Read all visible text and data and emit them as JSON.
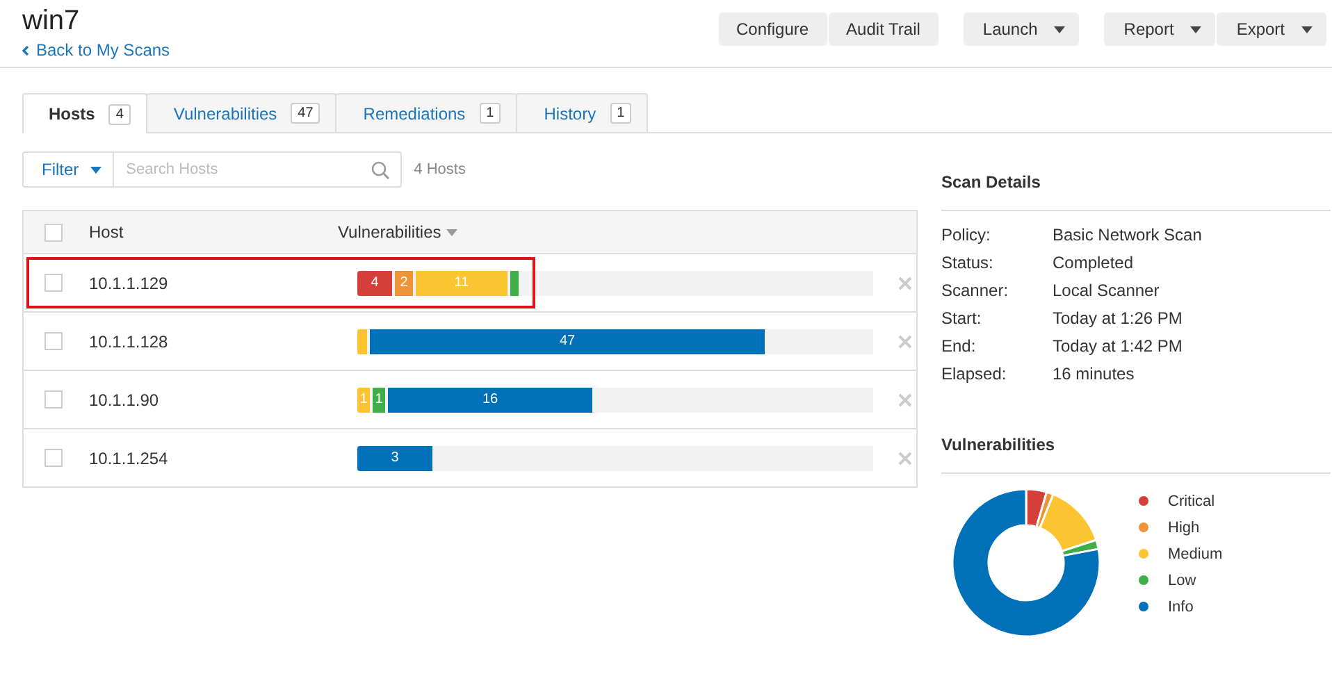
{
  "header": {
    "title": "win7",
    "back_link": "Back to My Scans",
    "button_groups": [
      [
        {
          "label": "Configure",
          "dropdown": false
        },
        {
          "label": "Audit Trail",
          "dropdown": false
        }
      ],
      [
        {
          "label": "Launch",
          "dropdown": true
        }
      ],
      [
        {
          "label": "Report",
          "dropdown": true
        },
        {
          "label": "Export",
          "dropdown": true
        }
      ]
    ]
  },
  "tabs": [
    {
      "label": "Hosts",
      "count": "4",
      "selected": true
    },
    {
      "label": "Vulnerabilities",
      "count": "47",
      "selected": false
    },
    {
      "label": "Remediations",
      "count": "1",
      "selected": false
    },
    {
      "label": "History",
      "count": "1",
      "selected": false
    }
  ],
  "filter": {
    "label": "Filter",
    "placeholder": "Search Hosts",
    "result_count": "4 Hosts"
  },
  "table": {
    "columns": [
      "Host",
      "Vulnerabilities"
    ],
    "all_checked": false,
    "rows": [
      {
        "host": "10.1.1.129",
        "checked": false,
        "highlighted": true,
        "segments": [
          {
            "label": "4",
            "color": "#d43f3a"
          },
          {
            "label": "2",
            "color": "#ee9336"
          },
          {
            "label": "11",
            "color": "#fdc431"
          },
          {
            "color": "#3fae49"
          }
        ]
      },
      {
        "host": "10.1.1.128",
        "checked": false,
        "highlighted": false,
        "segments": [
          {
            "color": "#fdc431"
          },
          {
            "label": "47",
            "color": "#0071b9"
          }
        ]
      },
      {
        "host": "10.1.1.90",
        "checked": false,
        "highlighted": false,
        "segments": [
          {
            "label": "1",
            "color": "#fdc431"
          },
          {
            "label": "1",
            "color": "#3fae49"
          },
          {
            "label": "16",
            "color": "#0071b9"
          }
        ]
      },
      {
        "host": "10.1.1.254",
        "checked": false,
        "highlighted": false,
        "segments": [
          {
            "label": "3",
            "color": "#0071b9"
          }
        ]
      }
    ]
  },
  "scan_details": {
    "title": "Scan Details",
    "fields": [
      {
        "label": "Policy:",
        "value": "Basic Network Scan"
      },
      {
        "label": "Status:",
        "value": "Completed"
      },
      {
        "label": "Scanner:",
        "value": "Local Scanner"
      },
      {
        "label": "Start:",
        "value": "Today at 1:26 PM"
      },
      {
        "label": "End:",
        "value": "Today at 1:42 PM"
      },
      {
        "label": "Elapsed:",
        "value": "16 minutes"
      }
    ]
  },
  "vulnerabilities_panel": {
    "title": "Vulnerabilities",
    "legend": [
      {
        "label": "Critical",
        "color": "#d43f3a"
      },
      {
        "label": "High",
        "color": "#ee9336"
      },
      {
        "label": "Medium",
        "color": "#fdc431"
      },
      {
        "label": "Low",
        "color": "#3fae49"
      },
      {
        "label": "Info",
        "color": "#0071b9"
      }
    ]
  }
}
